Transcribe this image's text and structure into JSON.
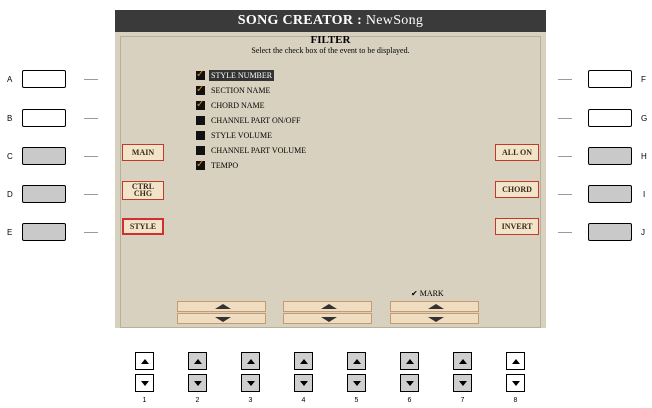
{
  "screen": {
    "title": "SONG CREATOR : ",
    "song_name": "NewSong",
    "filter_title": "FILTER",
    "instruction": "Select the check box of the event to be displayed."
  },
  "events": [
    {
      "label": "STYLE NUMBER",
      "checked": true,
      "selected": true
    },
    {
      "label": "SECTION NAME",
      "checked": true,
      "selected": false
    },
    {
      "label": "CHORD NAME",
      "checked": true,
      "selected": false
    },
    {
      "label": "CHANNEL PART ON/OFF",
      "checked": false,
      "selected": false
    },
    {
      "label": "STYLE VOLUME",
      "checked": false,
      "selected": false
    },
    {
      "label": "CHANNEL PART VOLUME",
      "checked": false,
      "selected": false
    },
    {
      "label": "TEMPO",
      "checked": true,
      "selected": false
    }
  ],
  "left_buttons": {
    "main": "MAIN",
    "ctrl_chg_1": "CTRL",
    "ctrl_chg_2": "CHG",
    "style": "STYLE"
  },
  "right_buttons": {
    "all_on": "ALL ON",
    "chord": "CHORD",
    "invert": "INVERT"
  },
  "mark_label": "✔ MARK",
  "side_letters": {
    "a": "A",
    "b": "B",
    "c": "C",
    "d": "D",
    "e": "E",
    "f": "F",
    "g": "G",
    "h": "H",
    "i": "I",
    "j": "J"
  },
  "number_labels": [
    "1",
    "2",
    "3",
    "4",
    "5",
    "6",
    "7",
    "8"
  ]
}
